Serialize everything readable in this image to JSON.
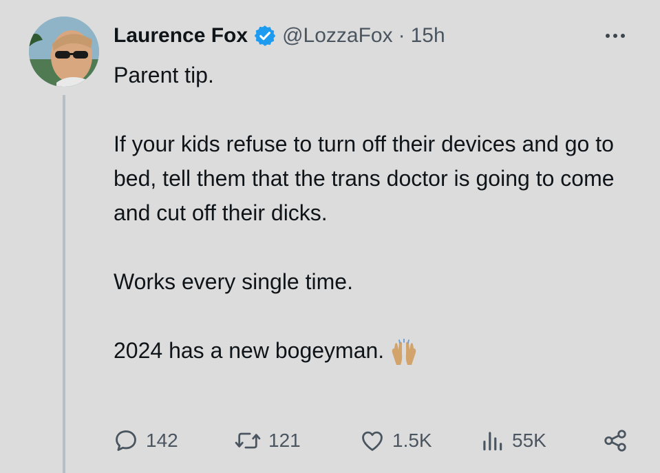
{
  "tweet": {
    "author_name": "Laurence Fox",
    "handle": "@LozzaFox",
    "separator": "·",
    "time": "15h",
    "lines": [
      "Parent tip.",
      "If your kids refuse to turn off their devices and go to bed, tell them that the trans doctor is going to come and cut off their dicks.",
      "Works every single time.",
      "2024 has a new bogeyman."
    ],
    "emoji": "raising-hands-emoji"
  },
  "actions": {
    "replies": "142",
    "reposts": "121",
    "likes": "1.5K",
    "views": "55K"
  },
  "colors": {
    "background": "#dcdcdc",
    "verified": "#1d9bf0",
    "muted": "#4a5560"
  }
}
